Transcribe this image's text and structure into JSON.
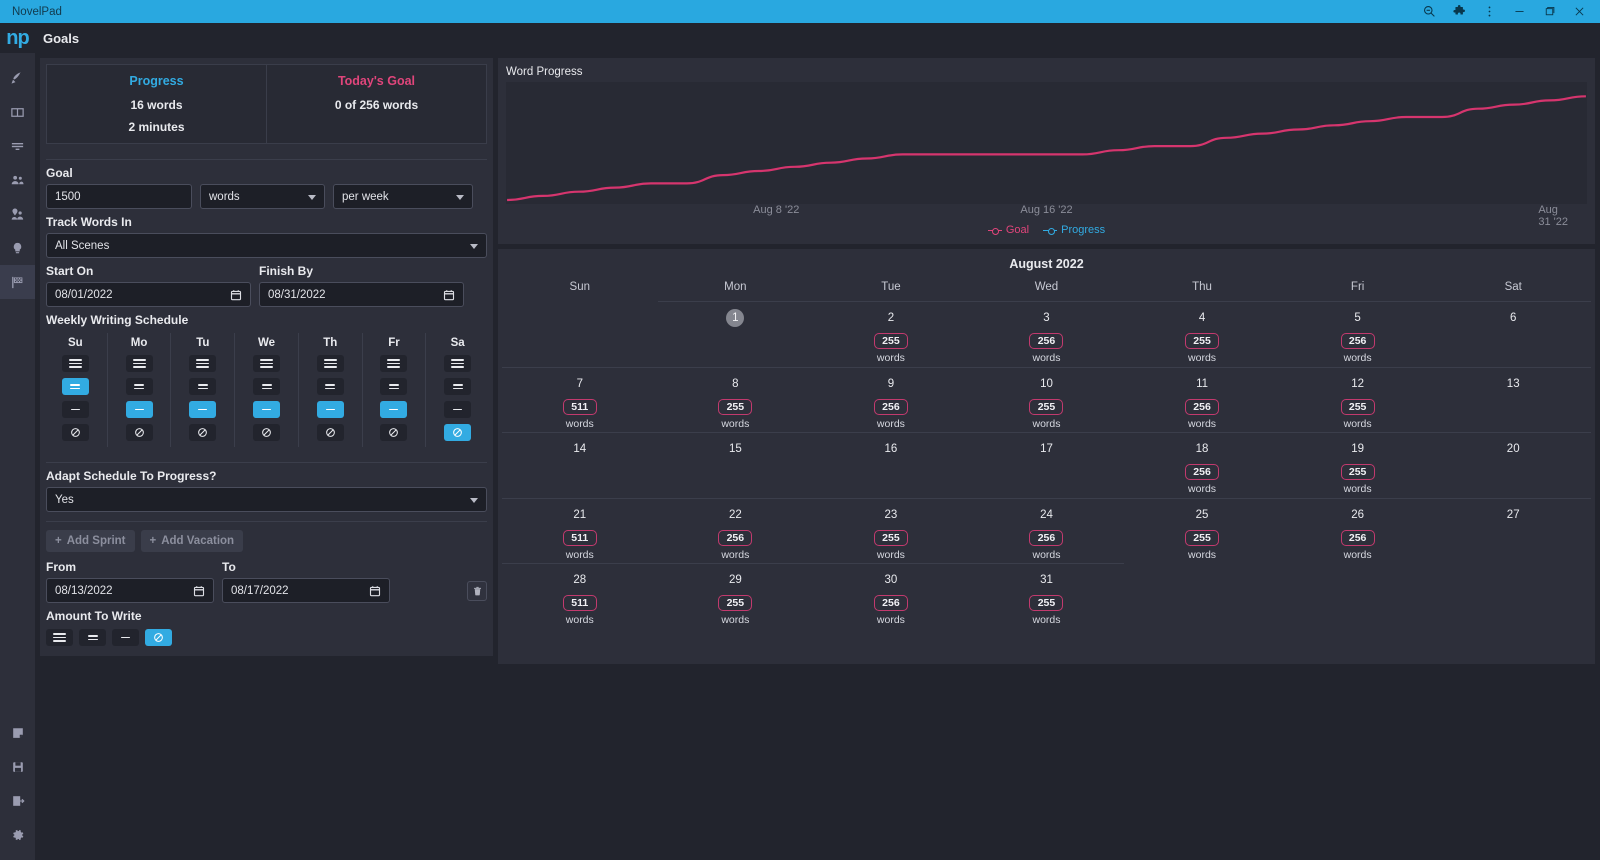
{
  "window": {
    "app_title": "NovelPad",
    "controls": [
      "search-icon",
      "extensions-icon",
      "more-icon",
      "minimize",
      "restore",
      "close"
    ]
  },
  "rail": {
    "logo": "np",
    "items": [
      {
        "name": "write-icon",
        "active": false
      },
      {
        "name": "board-icon",
        "active": false
      },
      {
        "name": "outline-icon",
        "active": false
      },
      {
        "name": "characters-icon",
        "active": false
      },
      {
        "name": "places-icon",
        "active": false
      },
      {
        "name": "ideas-icon",
        "active": false
      },
      {
        "name": "goals-flag-icon",
        "active": true
      }
    ],
    "bottom_items": [
      {
        "name": "notes-icon"
      },
      {
        "name": "save-icon"
      },
      {
        "name": "export-icon"
      },
      {
        "name": "settings-gear-icon"
      }
    ]
  },
  "page": {
    "title": "Goals"
  },
  "cards": {
    "progress": {
      "title": "Progress",
      "words": "16 words",
      "time": "2 minutes"
    },
    "today": {
      "title": "Today's Goal",
      "value": "0 of 256 words"
    }
  },
  "form": {
    "goal_label": "Goal",
    "goal_amount": "1500",
    "goal_unit": "words",
    "goal_period": "per week",
    "track_label": "Track Words In",
    "track_value": "All Scenes",
    "start_label": "Start On",
    "start_value": "08/01/2022",
    "finish_label": "Finish By",
    "finish_value": "08/31/2022",
    "schedule_label": "Weekly Writing Schedule",
    "days": [
      {
        "abbr": "Su",
        "level": 1
      },
      {
        "abbr": "Mo",
        "level": 2
      },
      {
        "abbr": "Tu",
        "level": 2
      },
      {
        "abbr": "We",
        "level": 2
      },
      {
        "abbr": "Th",
        "level": 2
      },
      {
        "abbr": "Fr",
        "level": 2
      },
      {
        "abbr": "Sa",
        "level": 3
      }
    ],
    "adapt_label": "Adapt Schedule To Progress?",
    "adapt_value": "Yes",
    "add_sprint": "Add Sprint",
    "add_vacation": "Add Vacation",
    "from_label": "From",
    "from_value": "08/13/2022",
    "to_label": "To",
    "to_value": "08/17/2022",
    "amount_label": "Amount To Write",
    "amount_level": 3,
    "delete_icon": "trash-icon"
  },
  "chart_data": {
    "type": "line",
    "title": "Word Progress",
    "xlabel": "",
    "ylabel": "",
    "grid": false,
    "legend_position": "bottom",
    "xticks": [
      "Aug 8 '22",
      "Aug 16 '22",
      "Aug 31 '22"
    ],
    "xtick_positions": [
      0.25,
      0.5,
      0.97
    ],
    "series": [
      {
        "name": "Goal",
        "color": "#d6356e",
        "x": [
          1,
          2,
          3,
          4,
          5,
          6,
          7,
          8,
          9,
          10,
          11,
          12,
          13,
          14,
          15,
          16,
          17,
          18,
          19,
          20,
          21,
          22,
          23,
          24,
          25,
          26,
          27,
          28,
          29,
          30,
          31
        ],
        "values": [
          0,
          255,
          511,
          766,
          1022,
          1022,
          1533,
          1788,
          2044,
          2299,
          2555,
          2810,
          2810,
          2810,
          2810,
          2810,
          2810,
          3066,
          3321,
          3321,
          3832,
          4088,
          4343,
          4599,
          4854,
          5110,
          5110,
          5621,
          5876,
          6132,
          6387
        ]
      },
      {
        "name": "Progress",
        "color": "#32abe2",
        "x": [
          1
        ],
        "values": [
          16
        ]
      }
    ]
  },
  "calendar": {
    "month": "August 2022",
    "dow": [
      "Sun",
      "Mon",
      "Tue",
      "Wed",
      "Thu",
      "Fri",
      "Sat"
    ],
    "words_suffix": "words",
    "weeks": [
      [
        {
          "day": ""
        },
        {
          "day": "1",
          "today": true
        },
        {
          "day": "2",
          "words": "255"
        },
        {
          "day": "3",
          "words": "256"
        },
        {
          "day": "4",
          "words": "255"
        },
        {
          "day": "5",
          "words": "256"
        },
        {
          "day": "6"
        }
      ],
      [
        {
          "day": "7",
          "words": "511"
        },
        {
          "day": "8",
          "words": "255"
        },
        {
          "day": "9",
          "words": "256"
        },
        {
          "day": "10",
          "words": "255"
        },
        {
          "day": "11",
          "words": "256"
        },
        {
          "day": "12",
          "words": "255"
        },
        {
          "day": "13"
        }
      ],
      [
        {
          "day": "14"
        },
        {
          "day": "15"
        },
        {
          "day": "16"
        },
        {
          "day": "17"
        },
        {
          "day": "18",
          "words": "256"
        },
        {
          "day": "19",
          "words": "255"
        },
        {
          "day": "20"
        }
      ],
      [
        {
          "day": "21",
          "words": "511"
        },
        {
          "day": "22",
          "words": "256"
        },
        {
          "day": "23",
          "words": "255"
        },
        {
          "day": "24",
          "words": "256"
        },
        {
          "day": "25",
          "words": "255"
        },
        {
          "day": "26",
          "words": "256"
        },
        {
          "day": "27"
        }
      ],
      [
        {
          "day": "28",
          "words": "511"
        },
        {
          "day": "29",
          "words": "255"
        },
        {
          "day": "30",
          "words": "256"
        },
        {
          "day": "31",
          "words": "255"
        },
        {
          "day": ""
        },
        {
          "day": ""
        },
        {
          "day": ""
        }
      ]
    ]
  },
  "colors": {
    "accent": "#32abe2",
    "goal_pink": "#e0457b",
    "badge_border": "#c23a6e",
    "panel": "#2d2f3a",
    "bg": "#22242d"
  }
}
